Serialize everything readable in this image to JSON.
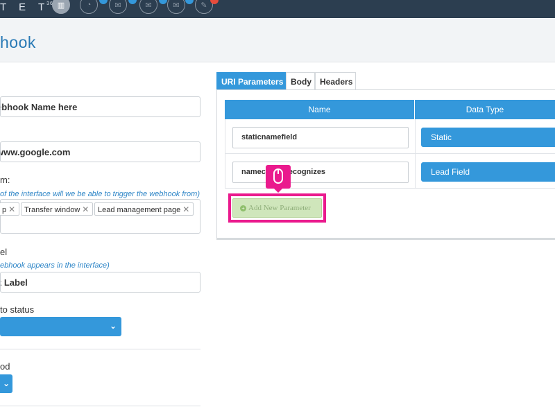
{
  "nav": {
    "brand": "T E T",
    "brand_sup": "360",
    "icons": [
      {
        "name": "reports-icon",
        "glyph": "▥"
      },
      {
        "name": "analytics-icon",
        "glyph": "◔"
      },
      {
        "name": "chat-icon",
        "glyph": "✉"
      },
      {
        "name": "inbox-icon",
        "glyph": "✉"
      },
      {
        "name": "mail-icon",
        "glyph": "✉"
      },
      {
        "name": "comments-icon",
        "glyph": "✎"
      }
    ]
  },
  "page": {
    "title": "hook"
  },
  "form": {
    "name_value": "ebhook Name here",
    "url_value": "www.google.com",
    "trigger_label": "m:",
    "trigger_hint": "of the interface will we be able to trigger the webhook from)",
    "tags": [
      "p",
      "Transfer window",
      "Lead management page"
    ],
    "label_label": "el",
    "label_hint": "ebhook appears in the interface)",
    "label_value": "k Label",
    "status_label": "to status",
    "method_label": "od"
  },
  "tabs": [
    "URI Parameters",
    "Body",
    "Headers"
  ],
  "table": {
    "headers": [
      "Name",
      "Data Type"
    ],
    "rows": [
      {
        "name": "staticnamefield",
        "type": "Static"
      },
      {
        "name": "namec          stemrecognizes",
        "type": "Lead Field"
      }
    ]
  },
  "add_button": {
    "label": "Add New Parameter"
  },
  "colors": {
    "accent": "#3498db",
    "highlight": "#ea1a8d",
    "nav_bg": "#2c3e50",
    "title": "#2879b5"
  }
}
